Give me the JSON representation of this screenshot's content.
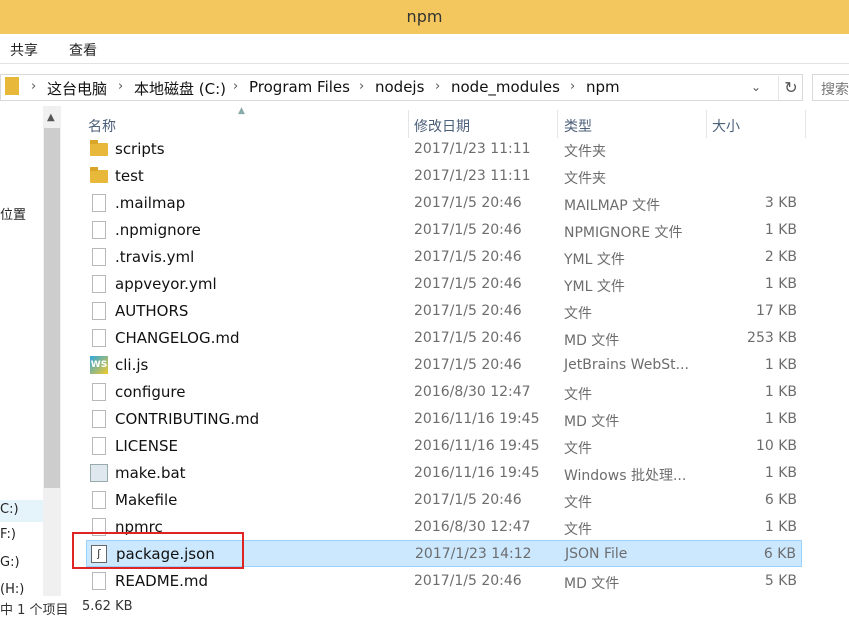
{
  "window": {
    "title": "npm",
    "accent": "#f3c75e"
  },
  "ribbon": {
    "tabs": [
      "共享",
      "查看"
    ]
  },
  "address": {
    "segments": [
      "这台电脑",
      "本地磁盘 (C:)",
      "Program Files",
      "nodejs",
      "node_modules",
      "npm"
    ],
    "search_placeholder": "搜索"
  },
  "nav": {
    "items": [
      "位置",
      "C:)",
      "F:)",
      "G:)",
      "(H:)"
    ]
  },
  "columns": {
    "name": "名称",
    "date": "修改日期",
    "type": "类型",
    "size": "大小"
  },
  "files": [
    {
      "name": "scripts",
      "date": "2017/1/23 11:11",
      "type": "文件夹",
      "size": "",
      "icon": "folder-icon"
    },
    {
      "name": "test",
      "date": "2017/1/23 11:11",
      "type": "文件夹",
      "size": "",
      "icon": "folder-icon"
    },
    {
      "name": ".mailmap",
      "date": "2017/1/5 20:46",
      "type": "MAILMAP 文件",
      "size": "3 KB",
      "icon": "file-icon"
    },
    {
      "name": ".npmignore",
      "date": "2017/1/5 20:46",
      "type": "NPMIGNORE 文件",
      "size": "1 KB",
      "icon": "file-icon"
    },
    {
      "name": ".travis.yml",
      "date": "2017/1/5 20:46",
      "type": "YML 文件",
      "size": "2 KB",
      "icon": "file-icon"
    },
    {
      "name": "appveyor.yml",
      "date": "2017/1/5 20:46",
      "type": "YML 文件",
      "size": "1 KB",
      "icon": "file-icon"
    },
    {
      "name": "AUTHORS",
      "date": "2017/1/5 20:46",
      "type": "文件",
      "size": "17 KB",
      "icon": "file-icon"
    },
    {
      "name": "CHANGELOG.md",
      "date": "2017/1/5 20:46",
      "type": "MD 文件",
      "size": "253 KB",
      "icon": "file-icon"
    },
    {
      "name": "cli.js",
      "date": "2017/1/5 20:46",
      "type": "JetBrains WebSt...",
      "size": "1 KB",
      "icon": "webstorm-icon"
    },
    {
      "name": "configure",
      "date": "2016/8/30 12:47",
      "type": "文件",
      "size": "1 KB",
      "icon": "file-icon"
    },
    {
      "name": "CONTRIBUTING.md",
      "date": "2016/11/16 19:45",
      "type": "MD 文件",
      "size": "1 KB",
      "icon": "file-icon"
    },
    {
      "name": "LICENSE",
      "date": "2016/11/16 19:45",
      "type": "文件",
      "size": "10 KB",
      "icon": "file-icon"
    },
    {
      "name": "make.bat",
      "date": "2016/11/16 19:45",
      "type": "Windows 批处理...",
      "size": "1 KB",
      "icon": "batch-file-icon"
    },
    {
      "name": "Makefile",
      "date": "2017/1/5 20:46",
      "type": "文件",
      "size": "6 KB",
      "icon": "file-icon"
    },
    {
      "name": "npmrc",
      "date": "2016/8/30 12:47",
      "type": "文件",
      "size": "1 KB",
      "icon": "file-icon"
    },
    {
      "name": "package.json",
      "date": "2017/1/23 14:12",
      "type": "JSON File",
      "size": "6 KB",
      "icon": "json-file-icon",
      "selected": true
    },
    {
      "name": "README.md",
      "date": "2017/1/5 20:46",
      "type": "MD 文件",
      "size": "5 KB",
      "icon": "file-icon"
    }
  ],
  "status": {
    "count": "中 1 个项目",
    "size": "5.62 KB"
  },
  "highlight_color": "#e02424"
}
